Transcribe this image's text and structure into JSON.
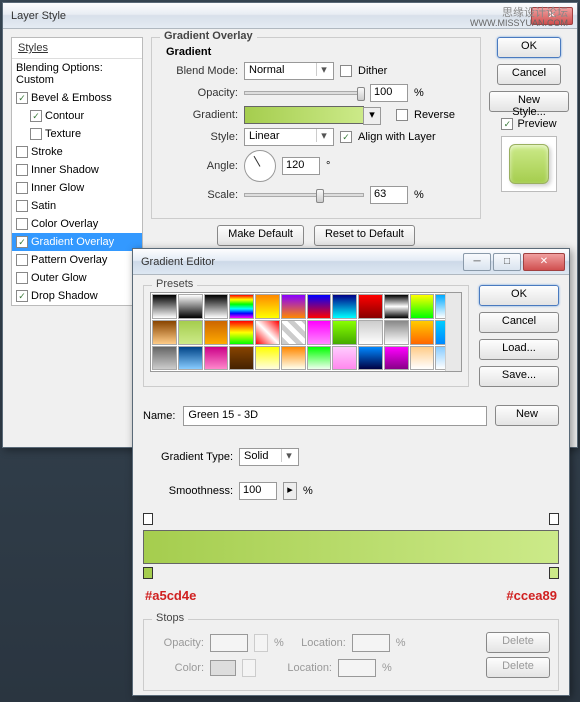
{
  "watermark": {
    "line1": "思缘设计论坛",
    "line2": "WWW.MISSYUAN.COM"
  },
  "layerStyle": {
    "title": "Layer Style",
    "stylesHeader": "Styles",
    "blendingOptions": "Blending Options: Custom",
    "items": [
      {
        "label": "Bevel & Emboss",
        "checked": true
      },
      {
        "label": "Contour",
        "checked": true,
        "indent": true
      },
      {
        "label": "Texture",
        "checked": false,
        "indent": true
      },
      {
        "label": "Stroke",
        "checked": false
      },
      {
        "label": "Inner Shadow",
        "checked": false
      },
      {
        "label": "Inner Glow",
        "checked": false
      },
      {
        "label": "Satin",
        "checked": false
      },
      {
        "label": "Color Overlay",
        "checked": false
      },
      {
        "label": "Gradient Overlay",
        "checked": true,
        "selected": true
      },
      {
        "label": "Pattern Overlay",
        "checked": false
      },
      {
        "label": "Outer Glow",
        "checked": false
      },
      {
        "label": "Drop Shadow",
        "checked": true
      }
    ],
    "section": {
      "title": "Gradient Overlay",
      "subtitle": "Gradient",
      "blendModeLabel": "Blend Mode:",
      "blendMode": "Normal",
      "dither": "Dither",
      "opacityLabel": "Opacity:",
      "opacity": "100",
      "pct": "%",
      "gradientLabel": "Gradient:",
      "reverse": "Reverse",
      "styleLabel": "Style:",
      "style": "Linear",
      "alignWithLayer": "Align with Layer",
      "angleLabel": "Angle:",
      "angle": "120",
      "deg": "°",
      "scaleLabel": "Scale:",
      "scale": "63",
      "makeDefault": "Make Default",
      "resetDefault": "Reset to Default"
    },
    "buttons": {
      "ok": "OK",
      "cancel": "Cancel",
      "newStyle": "New Style...",
      "preview": "Preview"
    }
  },
  "gradientEditor": {
    "title": "Gradient Editor",
    "presetsLabel": "Presets",
    "swatches": [
      "linear-gradient(#000,#fff)",
      "linear-gradient(#fff,#000)",
      "linear-gradient(#000,transparent)",
      "linear-gradient(#f00,#ff0,#0f0,#0ff,#00f,#f0f)",
      "linear-gradient(#f80,#ff0)",
      "linear-gradient(#80f,#f80)",
      "linear-gradient(#00f,#f00)",
      "linear-gradient(#008,#0ff)",
      "linear-gradient(#f00,#800)",
      "linear-gradient(#000,#fff,#000)",
      "linear-gradient(#ff0,#0f0)",
      "linear-gradient(#0af,#fff)",
      "linear-gradient(#840,#fc8)",
      "linear-gradient(#a5cd4e,#ccea89)",
      "linear-gradient(#c60,#fa0)",
      "linear-gradient(#f00,#ff0,#0f0)",
      "linear-gradient(45deg,#f00,#fff,#f00)",
      "repeating-linear-gradient(45deg,#ccc 0 5px,#fff 5px 10px)",
      "linear-gradient(#f0f,#f8f)",
      "linear-gradient(#8f0,#4a0)",
      "linear-gradient(#ccc,#fff)",
      "linear-gradient(#888,#fff)",
      "linear-gradient(#fc0,#f60)",
      "linear-gradient(#0cf,#08f)",
      "linear-gradient(#666,#ccc)",
      "linear-gradient(#048,#8cf)",
      "linear-gradient(#c08,#f8c)",
      "linear-gradient(#840,#420)",
      "linear-gradient(#ff0,#fffde0)",
      "linear-gradient(#f80,#ffe)",
      "linear-gradient(#0f0,#efe)",
      "linear-gradient(#fcf,#f8e)",
      "linear-gradient(#08f,#004)",
      "linear-gradient(#f0f,#808)",
      "linear-gradient(#fc8,#fff)",
      "linear-gradient(#8cf,#fff)"
    ],
    "nameLabel": "Name:",
    "name": "Green 15 - 3D",
    "new": "New",
    "gradTypeLabel": "Gradient Type:",
    "gradType": "Solid",
    "smoothLabel": "Smoothness:",
    "smooth": "100",
    "pct": "%",
    "hexLeft": "#a5cd4e",
    "hexRight": "#ccea89",
    "stopsLabel": "Stops",
    "opacityLabel": "Opacity:",
    "locationLabel": "Location:",
    "colorLabel": "Color:",
    "delete": "Delete",
    "buttons": {
      "ok": "OK",
      "cancel": "Cancel",
      "load": "Load...",
      "save": "Save..."
    }
  }
}
